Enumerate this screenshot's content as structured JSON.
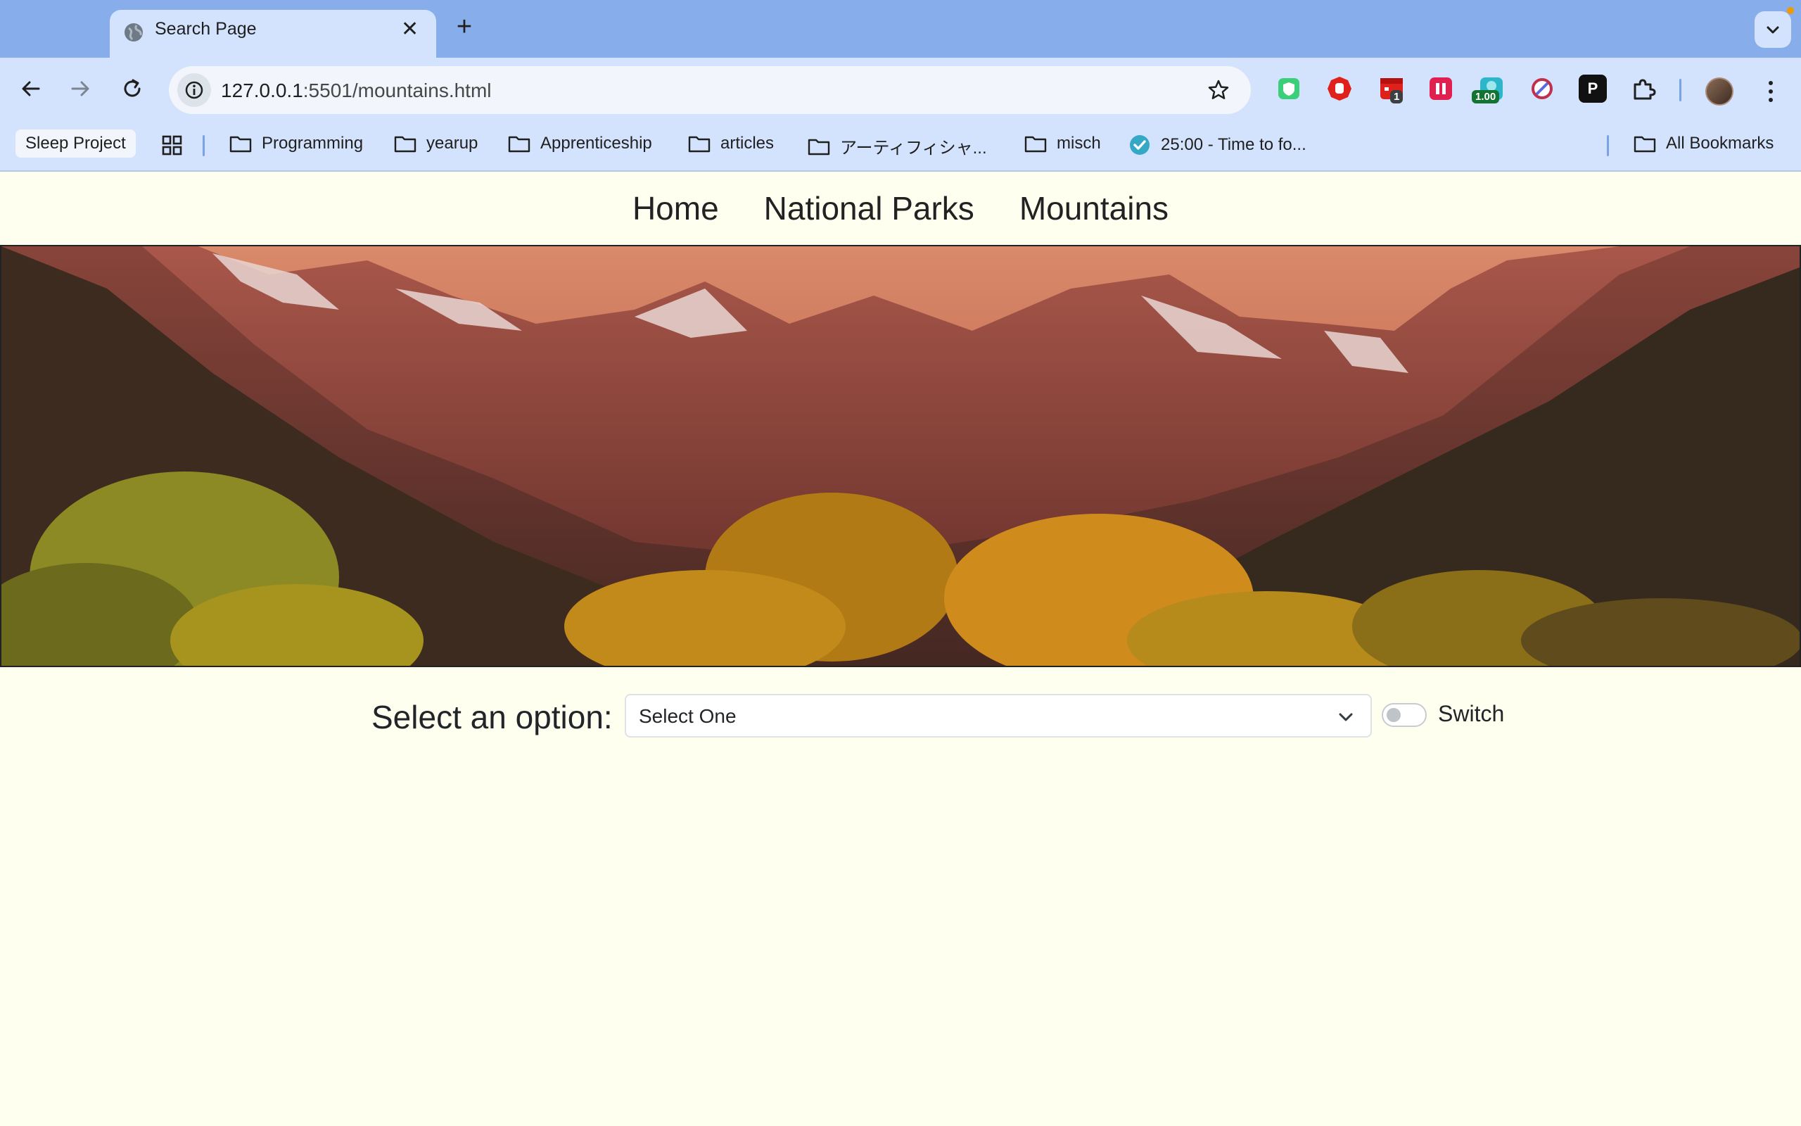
{
  "browser": {
    "tab": {
      "title": "Search Page",
      "close_glyph": "✕"
    },
    "new_tab_glyph": "+",
    "url": {
      "host": "127.0.0.1",
      "path": ":5501/mountains.html"
    },
    "extensions": [
      {
        "icon": "shield-extension-icon",
        "color": "#3ccf7a"
      },
      {
        "icon": "adblock-hand-icon",
        "color": "#e0201b"
      },
      {
        "icon": "calendar-extension-icon",
        "color": "#e0201b",
        "badge": "1"
      },
      {
        "icon": "pause-extension-icon",
        "color": "#e2204f"
      },
      {
        "icon": "speed-extension-icon",
        "color": "#2bb7c9",
        "badge": "1.00"
      },
      {
        "icon": "block-site-icon",
        "color": "#c0304d"
      },
      {
        "icon": "p-extension-icon",
        "color": "#111111",
        "label": "P"
      },
      {
        "icon": "puzzle-extensions-icon"
      }
    ],
    "bookmarks": {
      "pill": "Sleep Project",
      "items": [
        {
          "label": "Programming",
          "type": "folder"
        },
        {
          "label": "yearup",
          "type": "folder"
        },
        {
          "label": "Apprenticeship",
          "type": "folder"
        },
        {
          "label": "articles",
          "type": "folder"
        },
        {
          "label": "アーティフィシャ...",
          "type": "folder"
        },
        {
          "label": "misch",
          "type": "folder"
        },
        {
          "label": "25:00 - Time to fo...",
          "type": "link"
        }
      ],
      "all": "All Bookmarks"
    }
  },
  "page": {
    "nav": [
      "Home",
      "National Parks",
      "Mountains"
    ],
    "form": {
      "label": "Select an option:",
      "select_value": "Select One",
      "switch_label": "Switch",
      "switch_on": false
    }
  },
  "colors": {
    "page_background": "#fffff0",
    "browser_frame": "#87aeea",
    "toolbar": "#d3e3fd"
  }
}
